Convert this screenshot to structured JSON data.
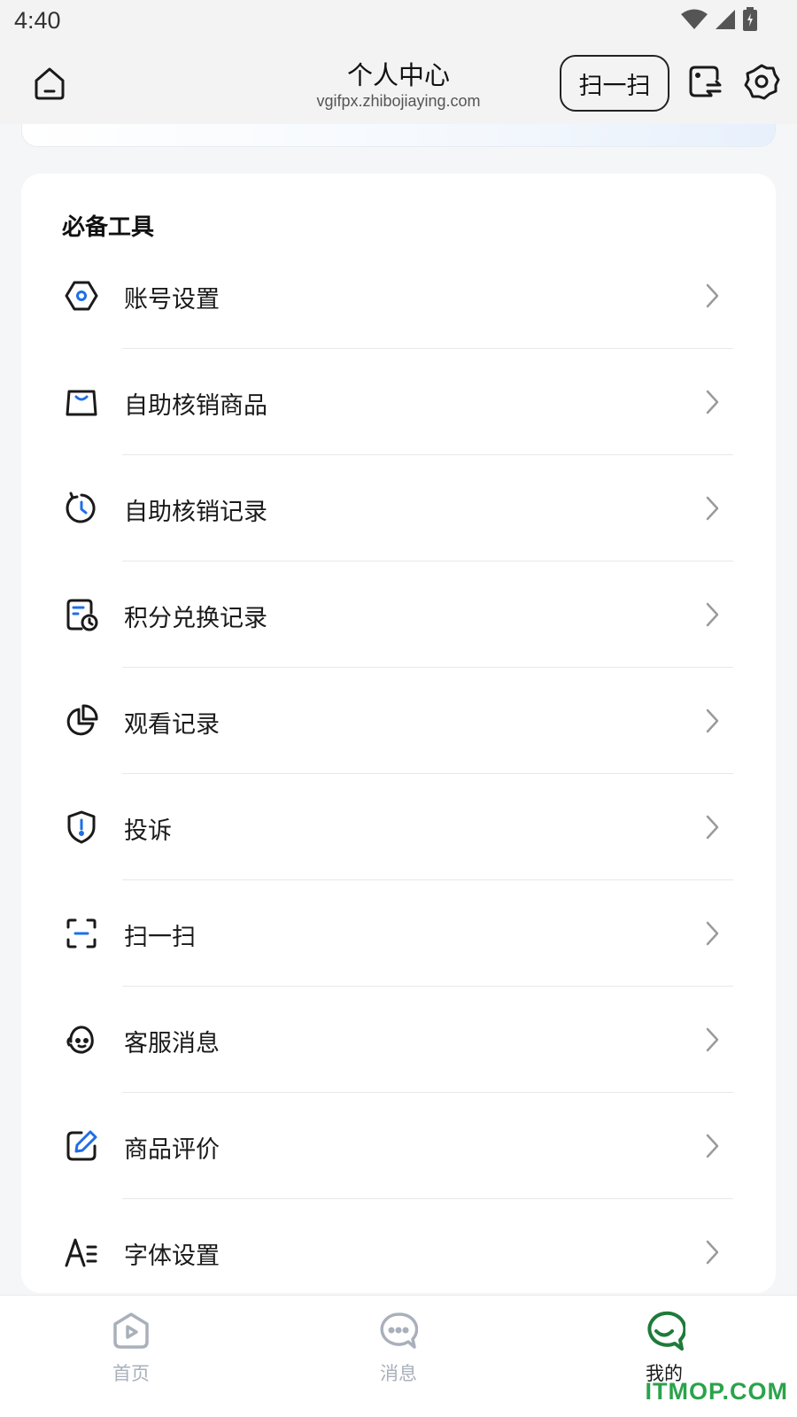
{
  "status_bar": {
    "time": "4:40"
  },
  "header": {
    "title": "个人中心",
    "url": "vgifpx.zhibojiaying.com",
    "scan_label": "扫一扫"
  },
  "tools": {
    "title": "必备工具",
    "items": [
      {
        "label": "账号设置",
        "icon": "settings-hexagon-icon"
      },
      {
        "label": "自助核销商品",
        "icon": "shopping-bag-icon"
      },
      {
        "label": "自助核销记录",
        "icon": "clock-history-icon"
      },
      {
        "label": "积分兑换记录",
        "icon": "document-clock-icon"
      },
      {
        "label": "观看记录",
        "icon": "pie-chart-icon"
      },
      {
        "label": "投诉",
        "icon": "shield-alert-icon"
      },
      {
        "label": "扫一扫",
        "icon": "scan-frame-icon"
      },
      {
        "label": "客服消息",
        "icon": "headset-face-icon"
      },
      {
        "label": "商品评价",
        "icon": "edit-pen-icon"
      },
      {
        "label": "字体设置",
        "icon": "font-size-icon"
      }
    ]
  },
  "tabbar": {
    "tabs": [
      {
        "label": "首页",
        "icon": "play-home-icon",
        "active": false
      },
      {
        "label": "消息",
        "icon": "chat-bubble-icon",
        "active": false
      },
      {
        "label": "我的",
        "icon": "smile-profile-icon",
        "active": true
      }
    ]
  },
  "colors": {
    "accent_blue": "#1e6fe6",
    "active_green": "#1f7a3a",
    "watermark_green": "#2aa34a"
  },
  "watermark": {
    "text": "ITMOP.COM"
  }
}
